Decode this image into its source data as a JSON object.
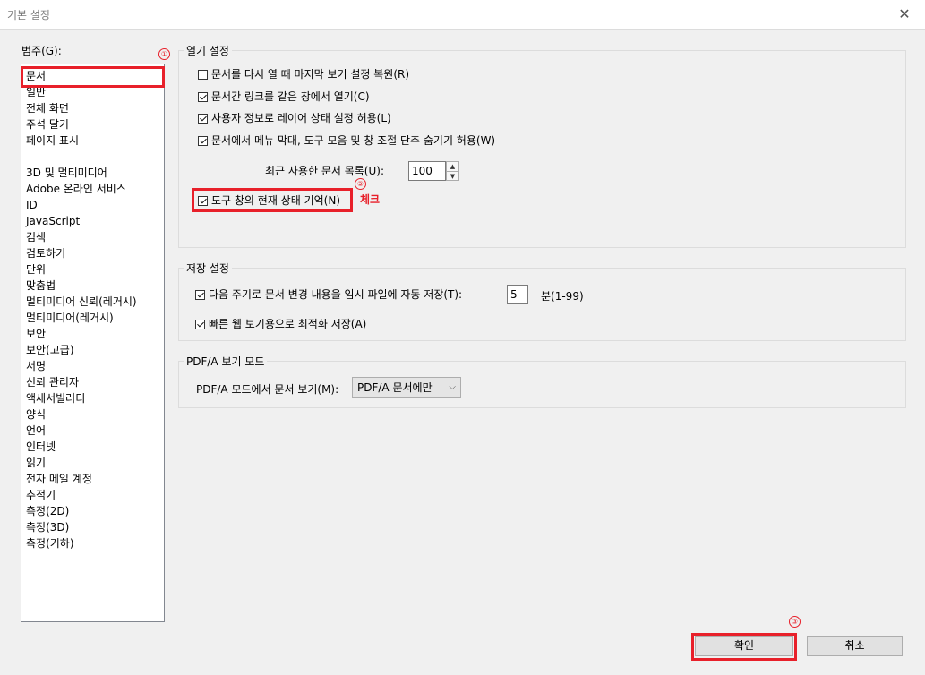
{
  "window": {
    "title": "기본 설정",
    "close_glyph": "✕"
  },
  "categories": {
    "label": "범주(G):",
    "group1": [
      "문서",
      "일반",
      "전체 화면",
      "주석 달기",
      "페이지 표시"
    ],
    "group2": [
      "3D 및 멀티미디어",
      "Adobe 온라인 서비스",
      "ID",
      "JavaScript",
      "검색",
      "검토하기",
      "단위",
      "맞춤법",
      "멀티미디어 신뢰(레거시)",
      "멀티미디어(레거시)",
      "보안",
      "보안(고급)",
      "서명",
      "신뢰 관리자",
      "액세서빌러티",
      "양식",
      "언어",
      "인터넷",
      "읽기",
      "전자 메일 계정",
      "추적기",
      "측정(2D)",
      "측정(3D)",
      "측정(기하)"
    ]
  },
  "open_settings": {
    "title": "열기 설정",
    "checkboxes": [
      {
        "label": "문서를 다시 열 때 마지막 보기 설정 복원(R)",
        "checked": false
      },
      {
        "label": "문서간 링크를 같은 창에서 열기(C)",
        "checked": true
      },
      {
        "label": "사용자 정보로 레이어 상태 설정 허용(L)",
        "checked": true
      },
      {
        "label": "문서에서 메뉴 막대, 도구 모음 및 창 조절 단추 숨기기 허용(W)",
        "checked": true
      }
    ],
    "recent_label": "최근 사용한 문서 목록(U):",
    "recent_value": "100",
    "remember_tools": {
      "label": "도구 창의 현재 상태 기억(N)",
      "checked": true
    }
  },
  "save_settings": {
    "title": "저장 설정",
    "autosave_label": "다음 주기로 문서 변경 내용을 임시 파일에 자동 저장(T):",
    "autosave_checked": true,
    "autosave_value": "5",
    "autosave_unit": "분(1-99)",
    "fast_web": {
      "label": "빠른 웹 보기용으로 최적화 저장(A)",
      "checked": true
    }
  },
  "pdfa": {
    "title": "PDF/A 보기 모드",
    "label": "PDF/A 모드에서 문서 보기(M):",
    "value": "PDF/A 문서에만"
  },
  "buttons": {
    "ok": "확인",
    "cancel": "취소"
  },
  "annotations": {
    "n1": "①",
    "n2": "②",
    "n3": "③",
    "check_text": "체크",
    "color": "#e8202a"
  }
}
